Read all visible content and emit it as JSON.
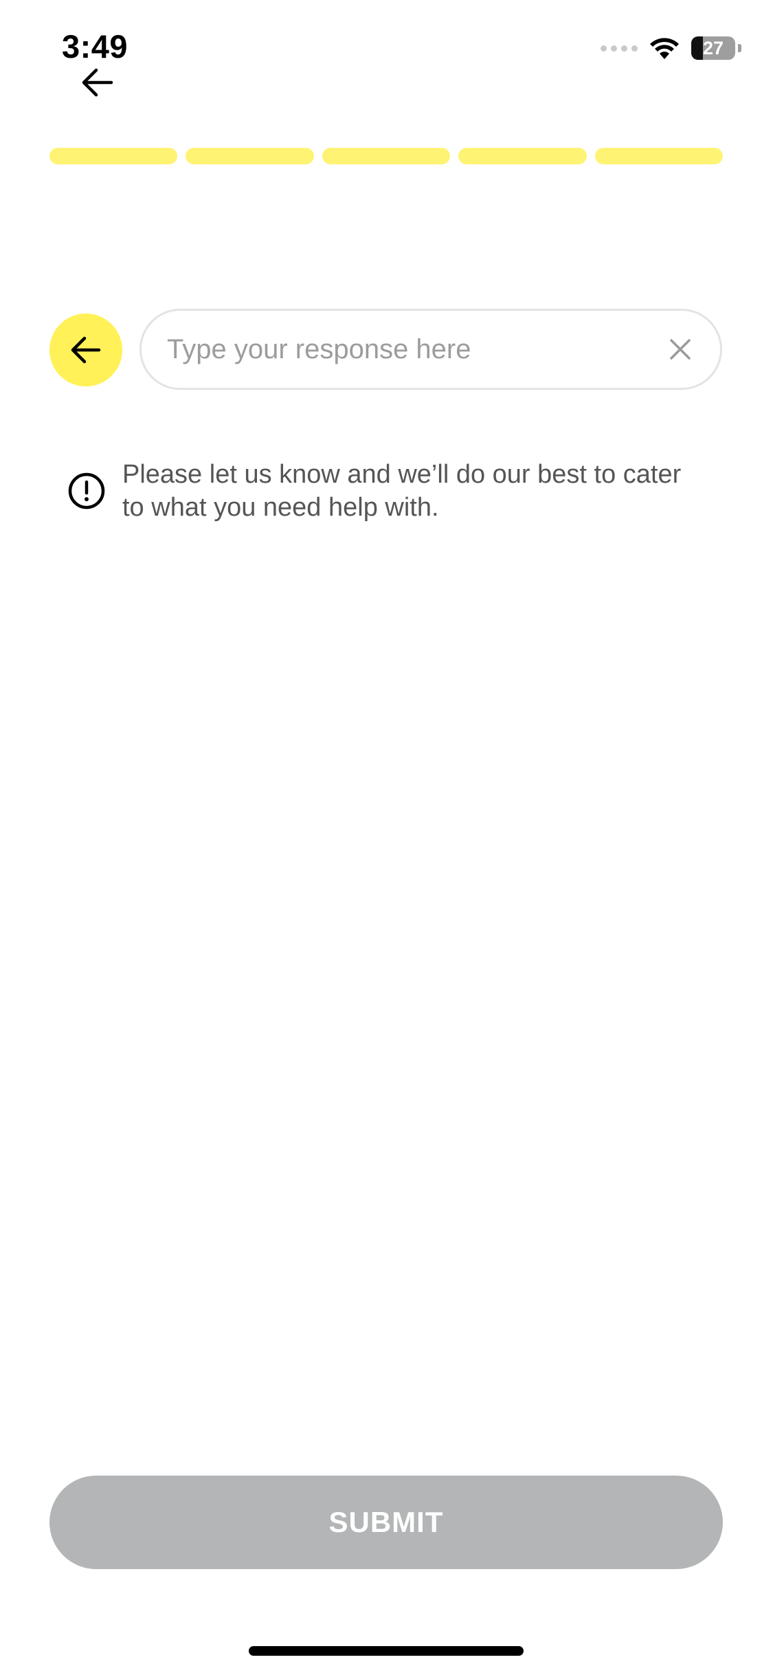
{
  "status_bar": {
    "time": "3:49",
    "battery_level": "27",
    "battery_fraction": 0.27,
    "icons": [
      "signal-dots-icon",
      "wifi-icon",
      "battery-icon"
    ]
  },
  "nav": {
    "back_icon": "arrow-left-icon"
  },
  "progress": {
    "total_steps": 5,
    "completed_steps": 5,
    "active_color": "#fff373"
  },
  "response": {
    "back_icon": "arrow-left-icon",
    "value": "",
    "placeholder": "Type your response here",
    "clear_icon": "close-icon"
  },
  "info": {
    "icon": "exclamation-circle-icon",
    "text_line1": "Please let us know and we’ll do our best to cater",
    "text_line2": "to what you need help with."
  },
  "submit": {
    "label": "SUBMIT",
    "color": "#b3b5b6",
    "enabled": false
  },
  "colors": {
    "accent": "#fff157",
    "progress": "#fff373",
    "submit_disabled": "#b3b5b6"
  }
}
